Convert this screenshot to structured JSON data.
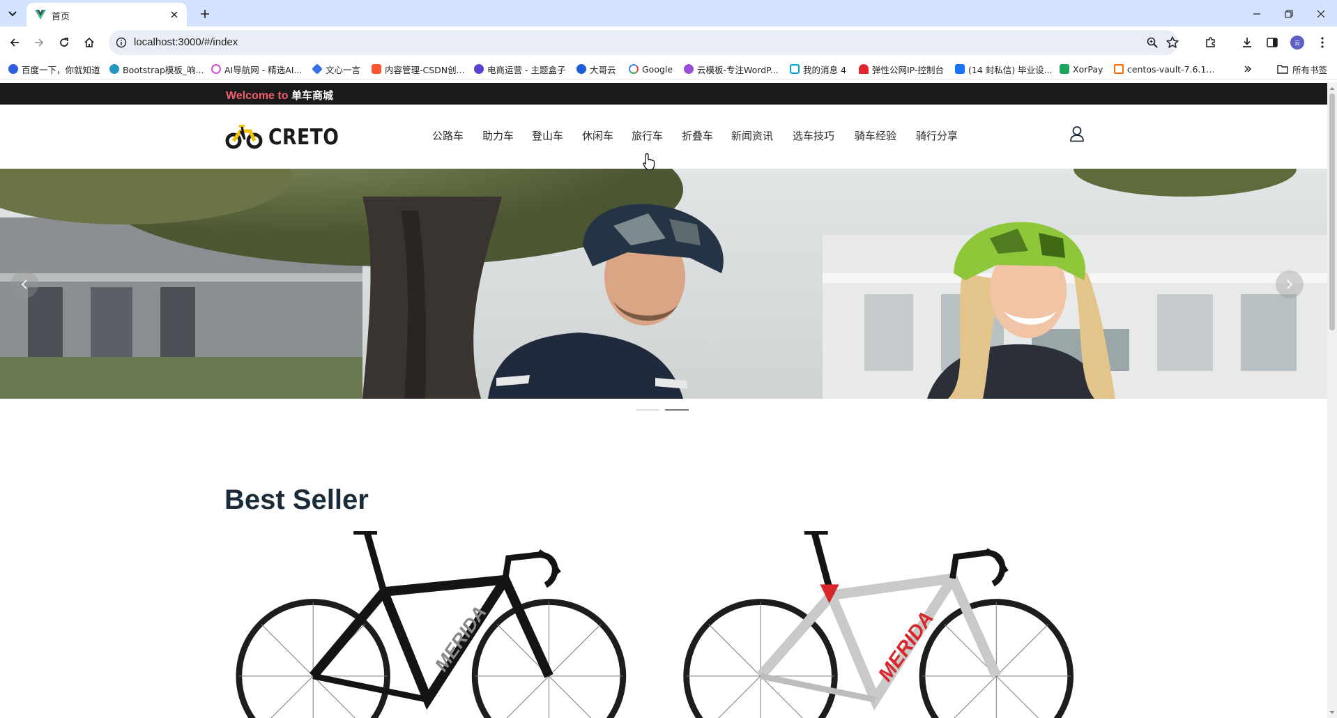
{
  "browser": {
    "tab_title": "首页",
    "url": "localhost:3000/#/index",
    "bookmarks": [
      {
        "label": "百度一下，你就知道",
        "icon": "paw-icon",
        "color": "#2f5fe0"
      },
      {
        "label": "Bootstrap模板_响...",
        "icon": "bootstrap-icon",
        "color": "#2596be"
      },
      {
        "label": "AI导航网 - 精选AI...",
        "icon": "ai-nav-icon",
        "color": "#d94fd4"
      },
      {
        "label": "文心一言",
        "icon": "wenxin-icon",
        "color": "#3a6ee8"
      },
      {
        "label": "内容管理-CSDN创...",
        "icon": "csdn-icon",
        "color": "#fc5531"
      },
      {
        "label": "电商运营 - 主题盒子",
        "icon": "theme-box-icon",
        "color": "#5b3fd1"
      },
      {
        "label": "大哥云",
        "icon": "cloud-icon",
        "color": "#1e5bd6"
      },
      {
        "label": "Google",
        "icon": "google-icon",
        "color": "#4285f4"
      },
      {
        "label": "云模板-专注WordP...",
        "icon": "yunmoban-icon",
        "color": "#9b4fd8"
      },
      {
        "label": "我的消息 4",
        "icon": "bilibili-icon",
        "color": "#00a1d6"
      },
      {
        "label": "弹性公网IP-控制台",
        "icon": "huawei-icon",
        "color": "#e0262d"
      },
      {
        "label": "(14 封私信) 毕业设...",
        "icon": "zhihu-icon",
        "color": "#1772f6"
      },
      {
        "label": "XorPay",
        "icon": "xorpay-icon",
        "color": "#1aa35a"
      },
      {
        "label": "centos-vault-7.6.1...",
        "icon": "aliyun-icon",
        "color": "#ff6a00"
      }
    ],
    "all_bookmarks_label": "所有书签"
  },
  "site": {
    "welcome_prefix": "Welcome to",
    "welcome_name": "单车商城",
    "logo_text": "CRETO",
    "nav": [
      "公路车",
      "助力车",
      "登山车",
      "休闲车",
      "旅行车",
      "折叠车",
      "新闻资讯",
      "选车技巧",
      "骑车经验",
      "骑行分享"
    ],
    "banner": {
      "slide_count": 2,
      "active_slide": 2
    },
    "best_seller_title": "Best Seller",
    "products": [
      {
        "brand_mark": "MERIDA",
        "frame_color": "#141414",
        "accent_color": "#555555"
      },
      {
        "brand_mark": "MERIDA",
        "frame_color": "#c9c9c7",
        "accent_color": "#d8262c"
      }
    ]
  }
}
